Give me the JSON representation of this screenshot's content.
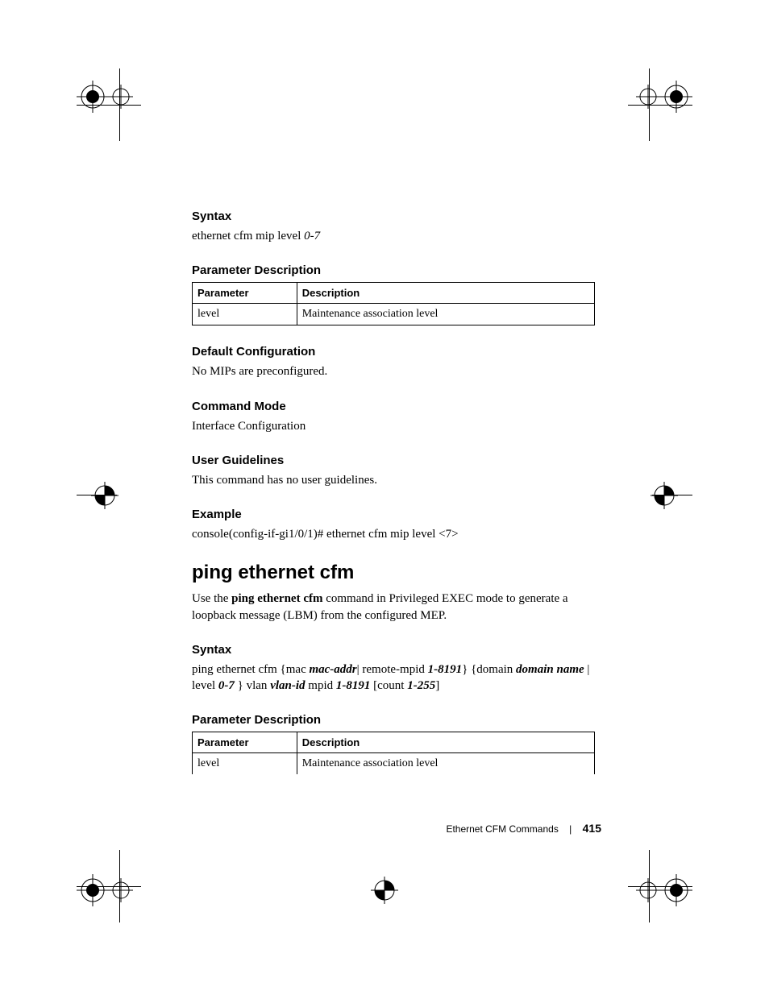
{
  "syntax1": {
    "heading": "Syntax",
    "text_prefix": "ethernet cfm mip level ",
    "text_arg": "0-7"
  },
  "param1": {
    "heading": "Parameter Description",
    "col1": "Parameter",
    "col2": "Description",
    "row1_param": "level",
    "row1_desc": "Maintenance association level"
  },
  "default_config": {
    "heading": "Default Configuration",
    "text": "No MIPs are preconfigured."
  },
  "command_mode": {
    "heading": "Command Mode",
    "text": "Interface Configuration"
  },
  "user_guidelines": {
    "heading": "User Guidelines",
    "text": "This command has no user guidelines."
  },
  "example": {
    "heading": "Example",
    "text": "console(config-if-gi1/0/1)# ethernet cfm mip level <7>"
  },
  "main": {
    "heading": "ping ethernet cfm",
    "text_p1": "Use the ",
    "text_bold": "ping ethernet cfm",
    "text_p2": " command in Privileged EXEC mode to generate a loopback message (LBM) from the configured MEP."
  },
  "syntax2": {
    "heading": "Syntax",
    "t1": "ping ethernet cfm {mac ",
    "a1": "mac-addr",
    "t2": "| remote-mpid ",
    "a2": "1-8191",
    "t3": "} {domain ",
    "a3": "domain name",
    "t4": " | level ",
    "a4": "0-7 ",
    "t5": "} vlan ",
    "a5": "vlan-id ",
    "t6": "mpid ",
    "a6": "1-8191 ",
    "t7": "[count ",
    "a7": "1-255",
    "t8": "]"
  },
  "param2": {
    "heading": "Parameter Description",
    "col1": "Parameter",
    "col2": "Description",
    "row1_param": "level",
    "row1_desc": "Maintenance association level"
  },
  "footer": {
    "section": "Ethernet CFM Commands",
    "page": "415"
  }
}
